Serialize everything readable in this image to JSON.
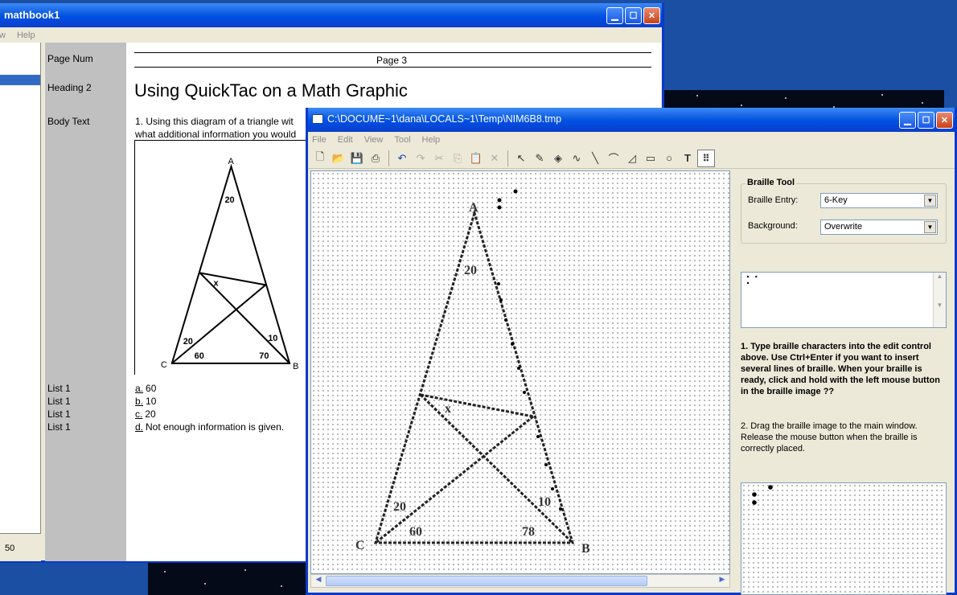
{
  "left_window": {
    "title": "mathbook1",
    "menu": [
      "w",
      "Help"
    ],
    "status_value": "50",
    "labels": {
      "page_num": "Page Num",
      "heading": "Heading 2",
      "body": "Body Text",
      "list": "List 1"
    },
    "page_header": "Page 3",
    "heading_text": "Using QuickTac on a Math Graphic",
    "body_line1": "1. Using this diagram of a triangle wit",
    "body_line2": "what additional information you would",
    "list_items": [
      {
        "letter": "a.",
        "text": "60"
      },
      {
        "letter": "b.",
        "text": "10"
      },
      {
        "letter": "c.",
        "text": "20"
      },
      {
        "letter": "d.",
        "text": "Not enough information is given."
      }
    ],
    "diagram": {
      "vertices": {
        "a": "A",
        "b": "B",
        "c": "C"
      },
      "angles": {
        "top": "20",
        "x": "x",
        "left": "20",
        "right": "10",
        "base_left": "60",
        "base_right": "70"
      }
    }
  },
  "right_window": {
    "title": "C:\\DOCUME~1\\dana\\LOCALS~1\\Temp\\NIM6B8.tmp",
    "menu": [
      "File",
      "Edit",
      "View",
      "Tool",
      "Help"
    ],
    "icons": [
      "new-doc-icon",
      "open-folder-icon",
      "save-icon",
      "print-icon",
      "undo-icon",
      "redo-icon",
      "cut-icon",
      "copy-icon",
      "paste-icon",
      "delete-icon",
      "pointer-icon",
      "eraser-icon",
      "fill-icon",
      "freehand-icon",
      "line-icon",
      "curve-icon",
      "angle-icon",
      "rectangle-icon",
      "circle-icon",
      "text-icon",
      "braille-icon"
    ],
    "braille_diagram": {
      "vertices": {
        "a": "A",
        "b": "B",
        "c": "C"
      },
      "angles": {
        "top": "20",
        "x": "x",
        "left": "20",
        "right": "10",
        "base_left": "60",
        "base_right": "78"
      }
    },
    "panel": {
      "group_title": "Braille Tool",
      "entry_label": "Braille Entry:",
      "entry_value": "6-Key",
      "background_label": "Background:",
      "background_value": "Overwrite",
      "edit_text": "⠅⠁",
      "instruction1": "1. Type braille characters into the edit control above.  Use Ctrl+Enter if you want to insert several lines of braille. When your braille is ready, click and hold with the left mouse button in the braille image ??",
      "instruction2": "2. Drag the braille image to the main window. Release the mouse button when the braille is correctly placed."
    }
  }
}
